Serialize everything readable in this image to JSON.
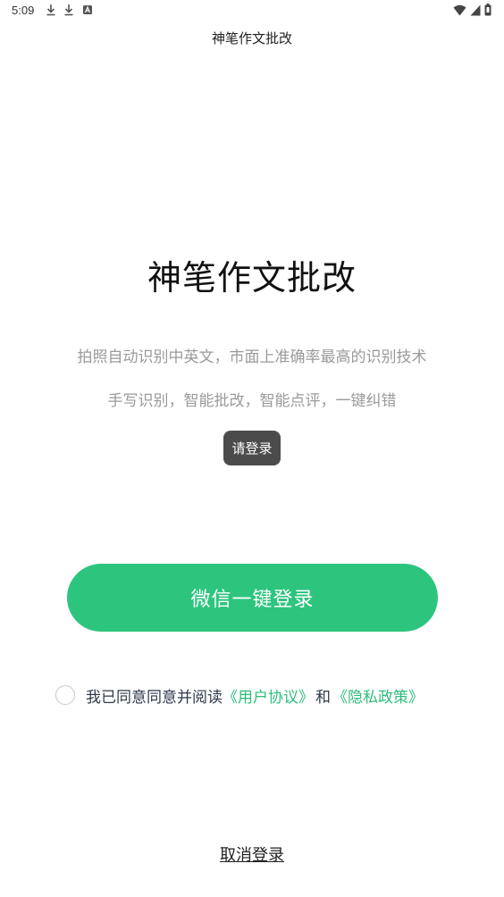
{
  "status_bar": {
    "time": "5:09",
    "left_icons": [
      "download-icon",
      "download-icon",
      "app-notification-icon"
    ],
    "right_icons": [
      "wifi-icon",
      "signal-icon",
      "battery-icon"
    ]
  },
  "app": {
    "title": "神笔作文批改"
  },
  "hero": {
    "title": "神笔作文批改",
    "tagline_1": "拍照自动识别中英文，市面上准确率最高的识别技术",
    "tagline_2": "手写识别，智能批改，智能点评，一键纠错"
  },
  "toast": {
    "text": "请登录"
  },
  "login": {
    "wechat_button_label": "微信一键登录"
  },
  "agreement": {
    "checked": false,
    "prefix": "我已同意同意并阅读",
    "user_agreement": "《用户协议》",
    "and": "和",
    "privacy_policy": "《隐私政策》"
  },
  "cancel": {
    "label": "取消登录"
  },
  "colors": {
    "accent_green": "#2dc57e",
    "link_green": "#2dbd7a",
    "toast_bg": "#4b4b4b",
    "tagline_gray": "#9a9a9a"
  }
}
